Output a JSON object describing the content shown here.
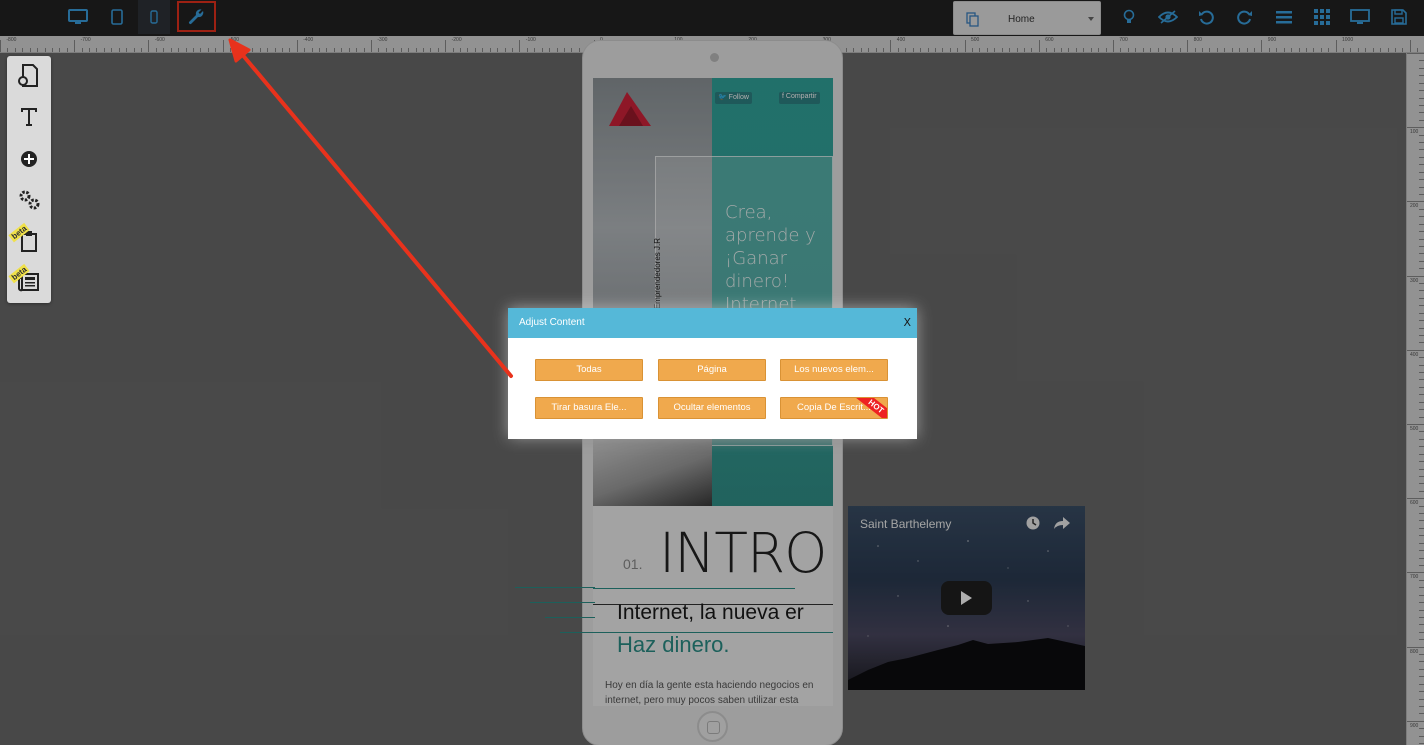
{
  "toolbar": {
    "device_icons": [
      "desktop-icon",
      "tablet-icon",
      "mobile-icon",
      "wrench-icon"
    ],
    "page_select": {
      "label": "Home",
      "icon": "pages-icon"
    },
    "right_icons": [
      "bulb-icon",
      "eye-icon",
      "undo-icon",
      "redo-icon",
      "menu-icon",
      "grid-icon",
      "monitor-icon",
      "save-icon"
    ],
    "accent": "#3aa0e0"
  },
  "ruler": {
    "h_labels": [
      "-800",
      "-700",
      "-600",
      "-500",
      "-400",
      "-300",
      "-200",
      "-100",
      "0",
      "100",
      "200",
      "300",
      "400",
      "500",
      "600",
      "700",
      "800",
      "900",
      "1000"
    ],
    "v_labels": [
      "100",
      "200",
      "300",
      "400",
      "500",
      "600",
      "700",
      "800",
      "900"
    ]
  },
  "tools": {
    "items": [
      "page-icon",
      "text-icon",
      "add-icon",
      "settings-icon",
      "clipboard-icon",
      "news-icon"
    ],
    "beta_label": "beta"
  },
  "mobile_page": {
    "hero": {
      "follow": "Follow",
      "share": "Compartir",
      "vertical_text": "Emprendedores J.R",
      "headline": "Crea,\naprende y\n¡Ganar\ndinero!\nInternet, una"
    },
    "intro": {
      "number": "01.",
      "title": "INTRO"
    },
    "article": {
      "headline": "Internet, la nueva er",
      "subheadline": "Haz dinero.",
      "body": "Hoy en día la gente esta haciendo negocios en internet, pero muy pocos saben utilizar esta"
    }
  },
  "video": {
    "title": "Saint Barthelemy"
  },
  "modal": {
    "title": "Adjust Content",
    "close": "X",
    "buttons": [
      "Todas",
      "Página",
      "Los nuevos elem...",
      "Tirar basura Ele...",
      "Ocultar elementos",
      "Copia De Escrit..."
    ],
    "hot_badge": "HOT",
    "button_color": "#f0a94d",
    "header_color": "#55b8d8"
  },
  "annotation": {
    "color": "#e8321c"
  }
}
